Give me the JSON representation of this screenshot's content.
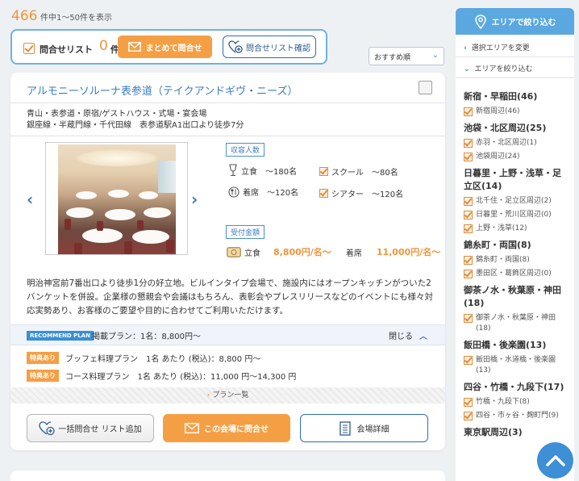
{
  "results": {
    "count": "466",
    "range": "件中1〜50件を表示"
  },
  "inquiry": {
    "label": "問合せリスト",
    "count": "0",
    "unit": "件",
    "bulk_button": "まとめて問合せ",
    "list_button": "問合せリスト確認"
  },
  "sort": {
    "selected": "おすすめ順"
  },
  "venue": {
    "title": "アルモニーソルーナ表参道（テイクアンドギヴ・ニーズ）",
    "info_line1": "青山・表参道・原宿/ゲストハウス・式場・宴会場",
    "info_line2": "銀座線・半蔵門線・千代田線　表参道駅A1出口より徒歩7分",
    "capacity_tag": "収容人数",
    "cap_standing": "立食　〜180名",
    "cap_school": "スクール　〜80名",
    "cap_seated": "着席　〜120名",
    "cap_theater": "シアター　〜120名",
    "price_tag": "受付金額",
    "price_standing_label": "立食",
    "price_standing": "8,800円/名〜",
    "price_seated_label": "着席",
    "price_seated": "11,000円/名〜",
    "description": "明治神宮前7番出口より徒歩1分の好立地。ビルインタイプ会場で、施設内にはオープンキッチンがついた2バンケットを併設。企業様の懇親会や会議はもちろん、表彰会やプレスリリースなどのイベントにも様々対応実勢あり、お客様のご要望や目的に合わせてご利用いただけます。",
    "recommend_badge": "RECOMMEND PLAN",
    "recommend_text": "掲載プラン：1名：8,800円〜",
    "close_label": "閉じる",
    "plans": [
      {
        "perk": "特典あり",
        "text": "ブッフェ料理プラン　1名 あたり (税込)：8,800 円〜"
      },
      {
        "perk": "特典あり",
        "text": "コース料理プラン　1名 あたり (税込)：11,000 円〜14,300 円"
      }
    ],
    "plan_list_label": "プラン一覧",
    "btn_add": "一括問合せ リスト追加",
    "btn_inquire": "この会場に問合せ",
    "btn_detail": "会場詳細"
  },
  "sidebar": {
    "header": "エリアで絞り込む",
    "change_area": "選択エリアを変更",
    "narrow_area": "エリアを絞り込む",
    "groups": [
      {
        "name": "新宿・早稲田(46)",
        "subs": [
          "新宿周辺(46)"
        ]
      },
      {
        "name": "池袋・北区周辺(25)",
        "subs": [
          "赤羽・北区周辺(1)",
          "池袋周辺(24)"
        ]
      },
      {
        "name": "日暮里・上野・浅草・足立区(14)",
        "subs": [
          "北千住・足立区周辺(2)",
          "日暮里・荒川区周辺(0)",
          "上野・浅草(12)"
        ]
      },
      {
        "name": "錦糸町・両国(8)",
        "subs": [
          "錦糸町・両国(8)",
          "墨田区・葛飾区周辺(0)"
        ]
      },
      {
        "name": "御茶ノ水・秋葉原・神田(18)",
        "subs": [
          "御茶ノ水・秋葉原・神田(18)"
        ]
      },
      {
        "name": "飯田橋・後楽園(13)",
        "subs": [
          "飯田橋・水道橋・後楽園(13)"
        ]
      },
      {
        "name": "四谷・竹橋・九段下(17)",
        "subs": [
          "竹橋・九段下(8)",
          "四谷・市ヶ谷・麹町門(9)"
        ]
      },
      {
        "name": "東京駅周辺(3)",
        "subs": []
      }
    ]
  },
  "colors": {
    "accent_blue": "#3a7cc1",
    "accent_orange": "#f59f45",
    "sidebar_header": "#5ba8e0"
  }
}
